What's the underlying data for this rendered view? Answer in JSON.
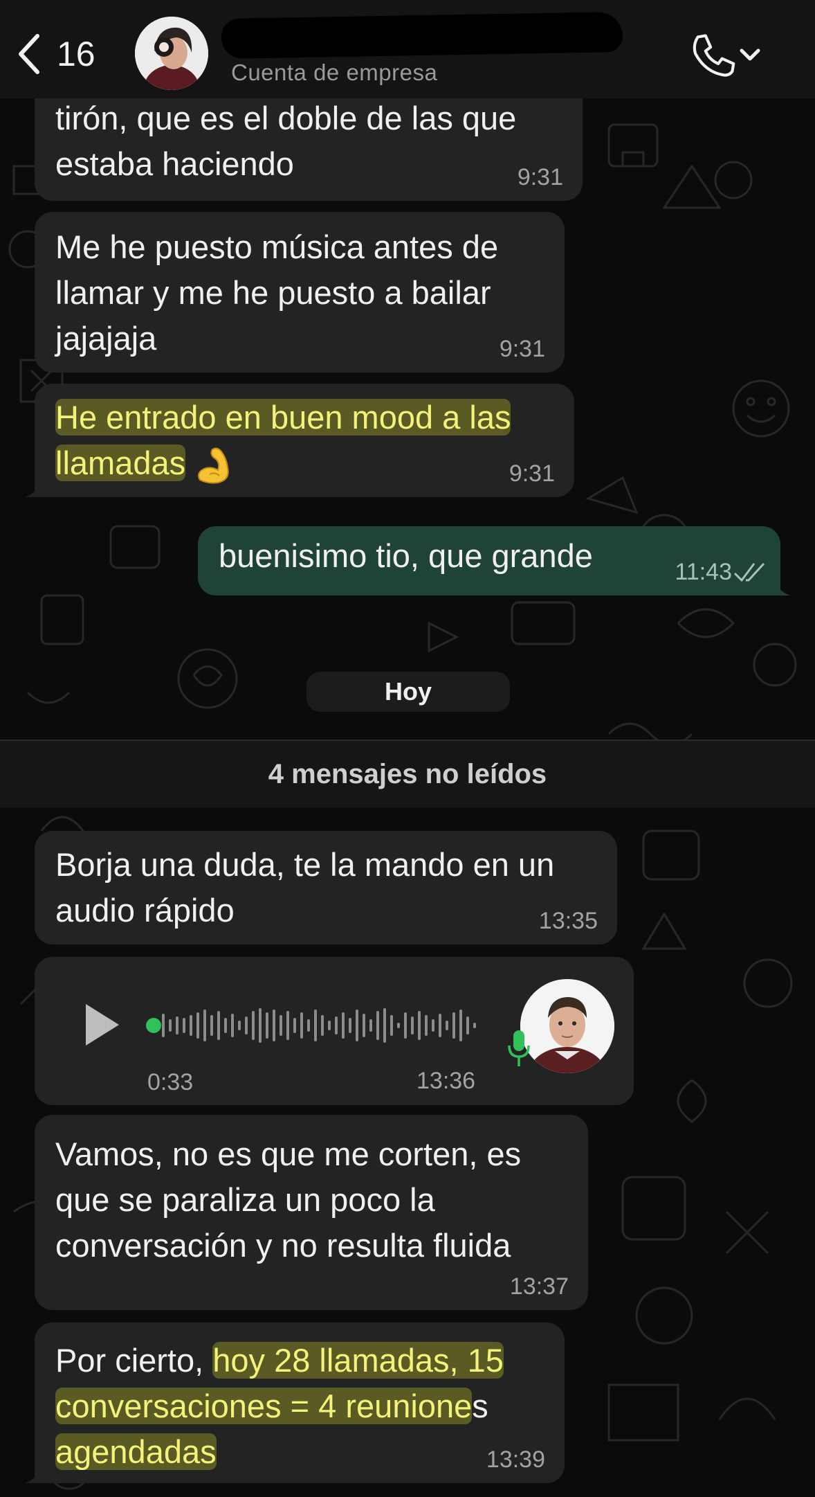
{
  "header": {
    "back_count": "16",
    "subtitle": "Cuenta de empresa",
    "icons": [
      "chevron-left-icon",
      "phone-icon",
      "chevron-down-icon"
    ]
  },
  "messages": [
    {
      "id": "m1",
      "direction": "in",
      "lines": [
        "tirón, que es el doble de las que",
        "estaba haciendo"
      ],
      "time": "9:31"
    },
    {
      "id": "m2",
      "direction": "in",
      "lines": [
        "Me he puesto música antes de",
        "llamar y me he puesto a bailar",
        "jajajaja"
      ],
      "time": "9:31"
    },
    {
      "id": "m3",
      "direction": "in",
      "lines": [
        "He entrado en buen mood a las",
        "llamadas"
      ],
      "emoji": "flexed-biceps-icon",
      "time": "9:31"
    },
    {
      "id": "m4",
      "direction": "out",
      "lines": [
        "buenisimo tio, que grande"
      ],
      "time": "11:43",
      "status": "read"
    },
    {
      "id": "m5",
      "direction": "in",
      "lines": [
        "Borja una duda, te la mando en un",
        "audio rápido"
      ],
      "time": "13:35"
    },
    {
      "id": "m7",
      "direction": "in",
      "lines": [
        "Vamos, no es que me corten, es",
        "que se paraliza un poco la",
        "conversación y no resulta fluida"
      ],
      "time": "13:37"
    },
    {
      "id": "m8",
      "direction": "in",
      "lines": [
        "Por cierto, ",
        "hoy 28 llamadas, 15",
        "conversaciones = 4 reunione",
        "s",
        "agendadas"
      ],
      "time": "13:39"
    }
  ],
  "voice_note": {
    "duration": "0:33",
    "time": "13:36",
    "progress": 0
  },
  "date_chip": "Hoy",
  "unread_banner": "4 mensajes no leídos",
  "colors": {
    "incoming": "#232323",
    "outgoing": "#1f4436",
    "highlight": "#f3f27a",
    "accent": "#25d366"
  }
}
